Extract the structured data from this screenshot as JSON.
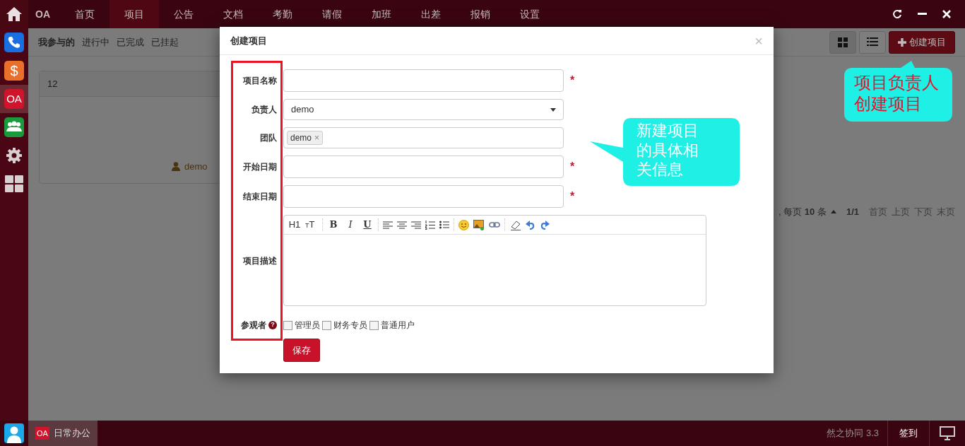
{
  "top_nav": {
    "brand": "OA",
    "items": [
      {
        "label": "首页",
        "selected": false
      },
      {
        "label": "项目",
        "selected": true
      },
      {
        "label": "公告",
        "selected": false
      },
      {
        "label": "文档",
        "selected": false
      },
      {
        "label": "考勤",
        "selected": false
      },
      {
        "label": "请假",
        "selected": false
      },
      {
        "label": "加班",
        "selected": false
      },
      {
        "label": "出差",
        "selected": false
      },
      {
        "label": "报销",
        "selected": false
      },
      {
        "label": "设置",
        "selected": false
      }
    ]
  },
  "sidebar": {
    "apps": [
      {
        "kind": "phone",
        "selected": false
      },
      {
        "kind": "finance",
        "label": "$",
        "selected": false
      },
      {
        "kind": "oa",
        "label": "OA",
        "selected": true
      },
      {
        "kind": "team",
        "selected": false
      },
      {
        "kind": "settings",
        "selected": false
      },
      {
        "kind": "apps",
        "selected": false
      }
    ]
  },
  "filter_tabs": [
    {
      "label": "我参与的",
      "selected": true
    },
    {
      "label": "进行中",
      "selected": false
    },
    {
      "label": "已完成",
      "selected": false
    },
    {
      "label": "已挂起",
      "selected": false
    }
  ],
  "view_toggle": [
    {
      "kind": "grid",
      "selected": true
    },
    {
      "kind": "list",
      "selected": false
    }
  ],
  "create_button": {
    "label": "创建项目"
  },
  "project_card": {
    "title": "12",
    "owner": "demo"
  },
  "pagination": {
    "summary": ", 每页 **10** 条",
    "page": "1/1",
    "links": [
      "首页",
      "上页",
      "下页",
      "末页"
    ]
  },
  "modal": {
    "title": "创建项目",
    "close": "×",
    "required_mark": "*",
    "fields": [
      {
        "kind": "text",
        "label": "项目名称",
        "required": true
      },
      {
        "kind": "select",
        "label": "负责人",
        "value": "demo",
        "required": false
      },
      {
        "kind": "tags",
        "label": "团队",
        "tags": [
          {
            "label": "demo",
            "remove": "×"
          }
        ],
        "required": false
      },
      {
        "kind": "text",
        "label": "开始日期",
        "required": true
      },
      {
        "kind": "text",
        "label": "结束日期",
        "required": true
      },
      {
        "kind": "editor",
        "label": "项目描述",
        "required": false
      }
    ],
    "editor_toolbar": [
      {
        "kind": "heading",
        "label": "H1"
      },
      {
        "kind": "font-size",
        "label": "TT"
      },
      {
        "kind": "separator"
      },
      {
        "kind": "bold",
        "label": "B"
      },
      {
        "kind": "italic",
        "label": "I"
      },
      {
        "kind": "underline",
        "label": "U"
      },
      {
        "kind": "separator"
      },
      {
        "kind": "align-left"
      },
      {
        "kind": "align-center"
      },
      {
        "kind": "align-right"
      },
      {
        "kind": "ordered-list"
      },
      {
        "kind": "bullet-list"
      },
      {
        "kind": "separator"
      },
      {
        "kind": "emoji"
      },
      {
        "kind": "image"
      },
      {
        "kind": "link"
      },
      {
        "kind": "separator"
      },
      {
        "kind": "eraser"
      },
      {
        "kind": "undo"
      },
      {
        "kind": "redo"
      }
    ],
    "viewers": {
      "label": "参观者",
      "help_mark": "?",
      "options": [
        {
          "label": "管理员",
          "checked": false
        },
        {
          "label": "财务专员",
          "checked": false
        },
        {
          "label": "普通用户",
          "checked": false
        }
      ]
    },
    "save_button": "保存"
  },
  "taskbar": {
    "apps": [
      {
        "badge": "OA",
        "label": "日常办公",
        "selected": true
      }
    ],
    "version": "然之协同 3.3",
    "checkin": "签到"
  },
  "callouts": [
    {
      "kind": "pointer-up",
      "text": "项目负责人创建项目",
      "color": "#e8102a"
    },
    {
      "kind": "pointer-left",
      "text": "新建项目的具体相关信息",
      "color": "#ffffff"
    }
  ]
}
